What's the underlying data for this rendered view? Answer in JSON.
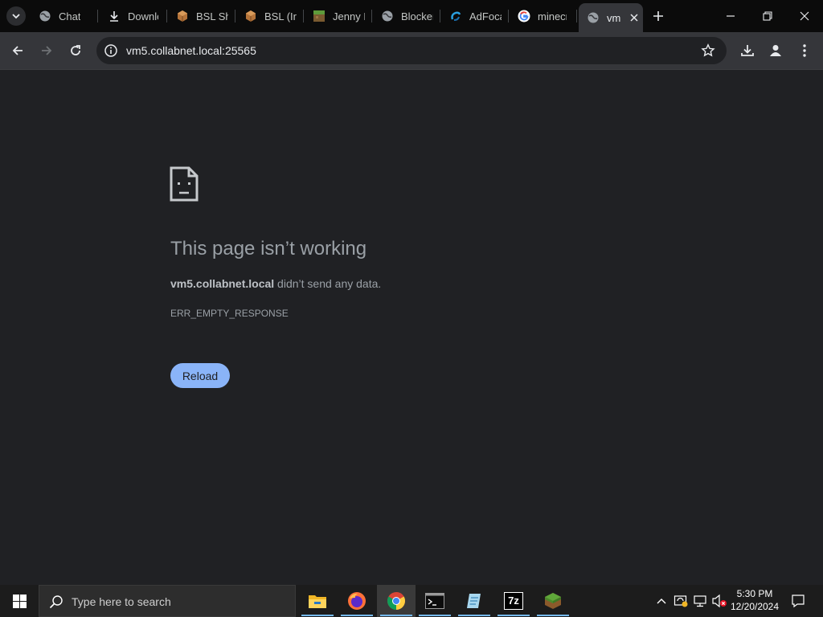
{
  "browser": {
    "tabs": [
      {
        "title": "Chat",
        "favicon": "globe-icon"
      },
      {
        "title": "Downlo",
        "favicon": "download-icon"
      },
      {
        "title": "BSL Sh",
        "favicon": "cube-icon"
      },
      {
        "title": "BSL (Iri",
        "favicon": "cube-icon"
      },
      {
        "title": "Jenny I",
        "favicon": "block-icon"
      },
      {
        "title": "Blocker",
        "favicon": "globe-icon"
      },
      {
        "title": "AdFoca",
        "favicon": "swirl-icon"
      },
      {
        "title": "minecr",
        "favicon": "google-icon"
      },
      {
        "title": "vm",
        "favicon": "globe-icon"
      }
    ],
    "active_tab": 8,
    "url": "vm5.collabnet.local:25565"
  },
  "error_page": {
    "title": "This page isn’t working",
    "host": "vm5.collabnet.local",
    "message": " didn’t send any data.",
    "code": "ERR_EMPTY_RESPONSE",
    "reload_label": "Reload"
  },
  "taskbar": {
    "search_placeholder": "Type here to search",
    "apps": [
      "file-explorer-icon",
      "firefox-icon",
      "chrome-icon",
      "terminal-icon",
      "notepad-icon",
      "7zip-icon",
      "minecraft-icon"
    ],
    "seven_zip_label": "7z",
    "time": "5:30 PM",
    "date": "12/20/2024"
  },
  "colors": {
    "accent": "#8ab4f8",
    "page_bg": "#202124",
    "toolbar_bg": "#35363a",
    "taskbar_bg": "#1c1c1c"
  }
}
